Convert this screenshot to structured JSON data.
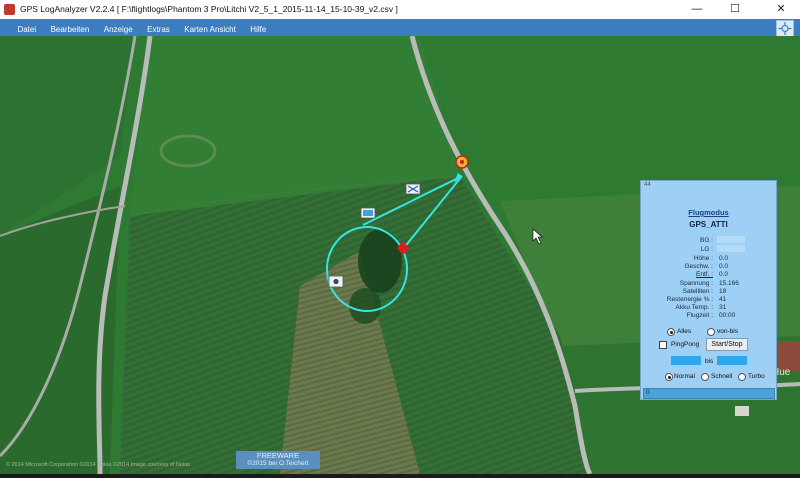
{
  "window": {
    "title": "GPS LogAnalyzer V2.2.4   [ F:\\flightlogs\\Phantom 3 Pro\\Litchi V2_5_1_2015-11-14_15-10-39_v2.csv ]",
    "minimize_glyph": "—",
    "maximize_glyph": "☐",
    "close_glyph": "✕"
  },
  "menu": {
    "items": [
      "Datei",
      "Bearbeiten",
      "Anzeige",
      "Extras",
      "Karten Ansicht",
      "Hilfe"
    ]
  },
  "panel": {
    "corner_text": "44",
    "title": "Flugmodus",
    "mode": "GPS_ATTI",
    "fields": [
      {
        "label": "BG :",
        "value": ""
      },
      {
        "label": "LG :",
        "value": ""
      },
      {
        "label": "Höhe :",
        "value": "0.0"
      },
      {
        "label": "Geschw. :",
        "value": "0.0"
      },
      {
        "label": "Entf. :",
        "value": "0.0"
      },
      {
        "label": "Spannung :",
        "value": "15.166"
      },
      {
        "label": "Satelliten :",
        "value": "18"
      },
      {
        "label": "Restenergie % :",
        "value": "41"
      },
      {
        "label": "Akku Temp. :",
        "value": "31"
      },
      {
        "label": "Flugzeit :",
        "value": "00:00"
      }
    ],
    "range_options": {
      "all": "Alles",
      "range": "von-bis"
    },
    "pingpong_label": "PingPong",
    "startstop_label": "Start/Stop",
    "bis_label": "bis",
    "speed_options": {
      "normal": "Normal",
      "fast": "Schnell",
      "turbo": "Turbo"
    },
    "bottom_value": "0"
  },
  "map": {
    "freeware_label": "FREEWARE",
    "freeware_sub": "©2015 bei O.Teichert",
    "copyright": "© 2014 Microsoft Corporation  ©2014 Nokia  ©2014 Image courtesy of Nokia",
    "edge_label": "Hue"
  },
  "colors": {
    "menubar": "#3b7dbf",
    "panel": "#9ecff5",
    "track": "#33e6e0",
    "grass": "#2f7a32",
    "road": "#b9bcb8"
  }
}
